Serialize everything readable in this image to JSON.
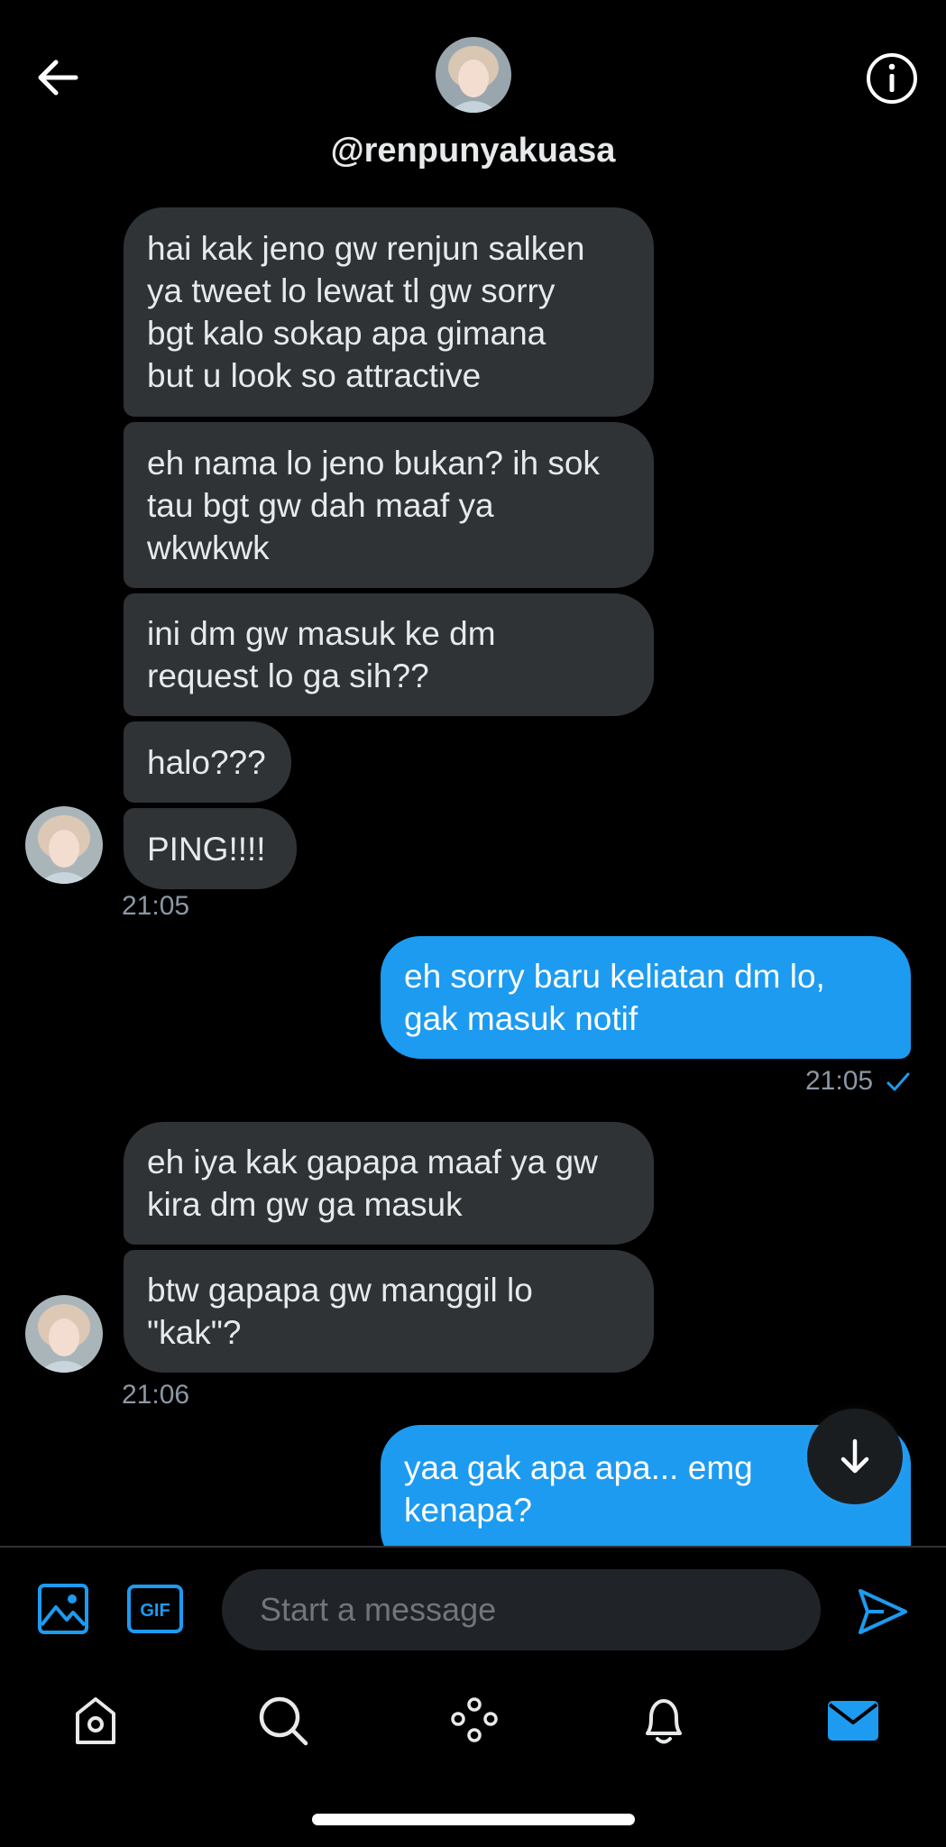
{
  "header": {
    "handle": "@renpunyakuasa",
    "back_icon": "arrow-left-icon",
    "info_icon": "info-icon"
  },
  "messages": [
    {
      "dir": "in",
      "lines": [
        "hai kak jeno gw renjun salken",
        "ya tweet lo lewat tl gw sorry",
        "bgt kalo sokap apa gimana",
        "but u look so attractive"
      ]
    },
    {
      "dir": "in",
      "lines": [
        "eh nama lo jeno bukan? ih sok",
        "tau bgt gw dah maaf ya",
        "wkwkwk"
      ]
    },
    {
      "dir": "in",
      "lines": [
        "ini dm gw masuk ke dm",
        "request lo ga sih??"
      ]
    },
    {
      "dir": "in",
      "lines": [
        "halo???"
      ]
    },
    {
      "dir": "in",
      "lines": [
        "PING!!!!"
      ]
    },
    {
      "dir": "out",
      "lines": [
        "eh sorry baru keliatan dm lo,",
        "gak masuk notif"
      ]
    },
    {
      "dir": "in",
      "lines": [
        "eh iya kak gapapa maaf ya gw",
        "kira dm gw ga masuk"
      ]
    },
    {
      "dir": "in",
      "lines": [
        "btw gapapa gw manggil lo",
        "\"kak\"?"
      ]
    },
    {
      "dir": "out",
      "lines": [
        "yaa gak apa apa... emg",
        "kenapa?"
      ]
    }
  ],
  "timestamps": {
    "group1": "21:05",
    "group2": "21:05",
    "group3": "21:06"
  },
  "composer": {
    "placeholder": "Start a message",
    "image_icon": "image-icon",
    "gif_label": "GIF",
    "send_icon": "send-icon"
  },
  "tabbar": {
    "items": [
      "home-icon",
      "search-icon",
      "spaces-icon",
      "notifications-bell-icon",
      "messages-mail-icon"
    ],
    "active": "messages-mail-icon"
  },
  "scroll_down_icon": "arrow-down-icon",
  "colors": {
    "accent": "#1d9bf0",
    "incoming_bubble": "#2f3336",
    "background": "#000000",
    "muted_text": "#8b98a5"
  }
}
